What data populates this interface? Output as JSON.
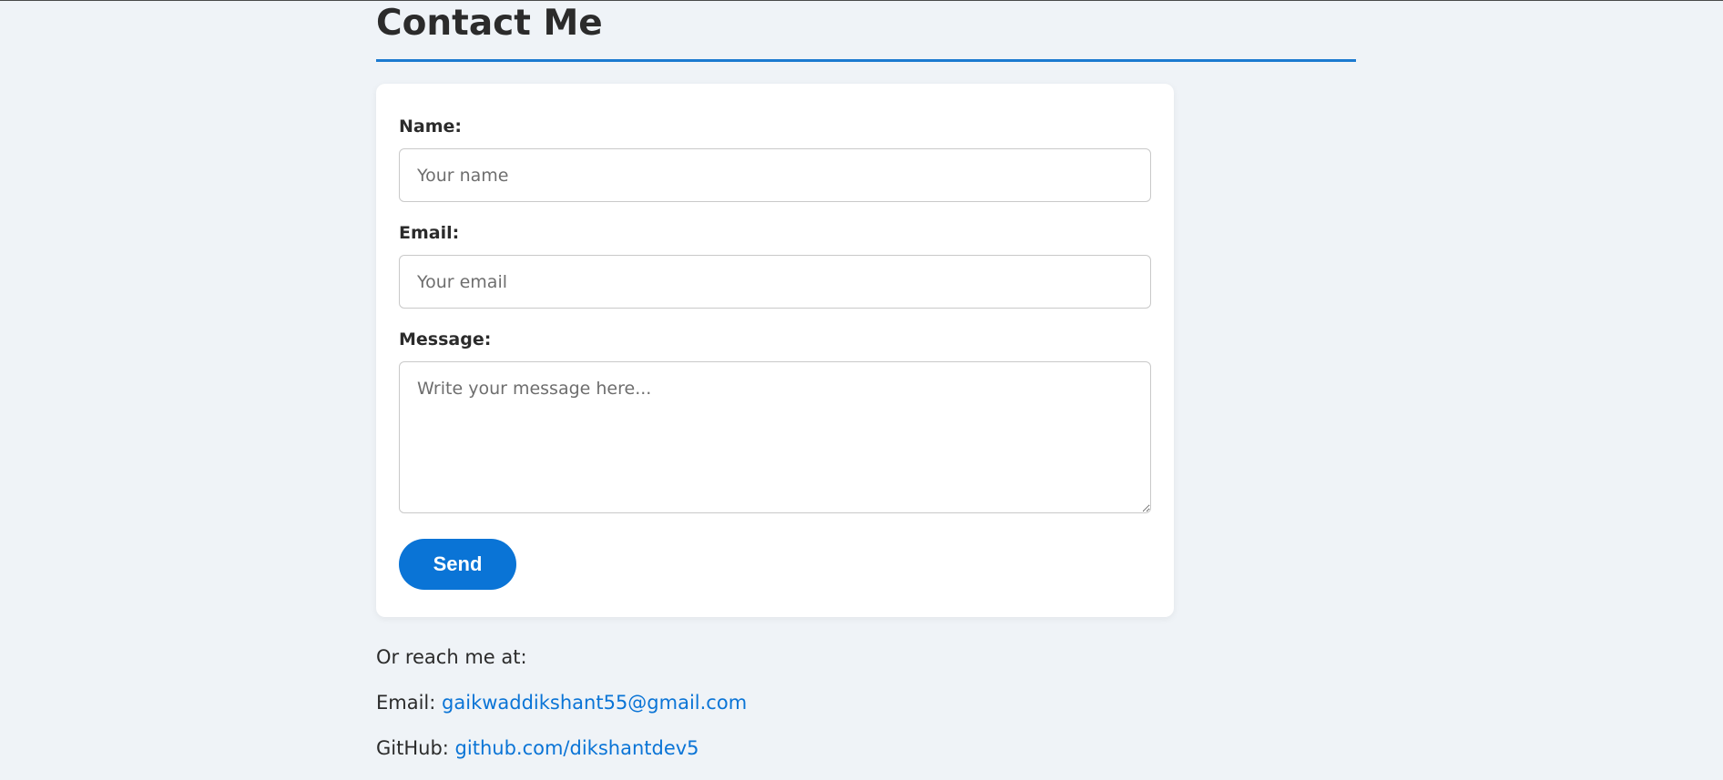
{
  "header": {
    "title": "Contact Me",
    "accent_color": "#1b7ad0"
  },
  "form": {
    "name_label": "Name:",
    "name_placeholder": "Your name",
    "name_value": "",
    "email_label": "Email:",
    "email_placeholder": "Your email",
    "email_value": "",
    "message_label": "Message:",
    "message_placeholder": "Write your message here...",
    "message_value": "",
    "send_label": "Send",
    "button_color": "#0a74d6"
  },
  "contact": {
    "intro": "Or reach me at:",
    "email_prefix": "Email:",
    "email_link": "gaikwaddikshant55@gmail.com",
    "github_prefix": "GitHub:",
    "github_link": "github.com/dikshantdev5",
    "link_color": "#0a74d6"
  }
}
